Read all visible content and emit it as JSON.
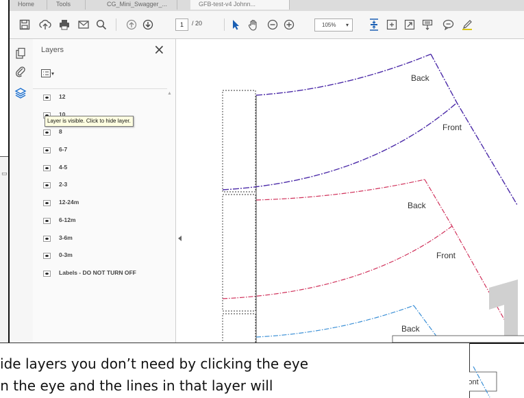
{
  "tabs": [
    "Home",
    "Tools",
    "CG_Mini_Swagger_...",
    "GFB-test-v4 Johnn..."
  ],
  "toolbar": {
    "page_current": "1",
    "page_total": "/ 20",
    "zoom": "105%"
  },
  "layers_panel": {
    "title": "Layers",
    "close_symbol": "×",
    "options_caret": "▾",
    "tooltip": "Layer is visible. Click to hide layer.",
    "layers": [
      "12",
      "10",
      "8",
      "6-7",
      "4-5",
      "2-3",
      "12-24m",
      "6-12m",
      "3-6m",
      "0-3m",
      "Labels - DO NOT TURN OFF"
    ]
  },
  "document": {
    "labels": {
      "back_1": "Back",
      "front_1": "Front",
      "back_2": "Back",
      "front_2": "Front",
      "back_3": "Back",
      "front_3": "Front"
    },
    "line_colors": {
      "purple": "#4b2aa8",
      "red": "#d0305a",
      "blue": "#3a8fd6"
    }
  },
  "callout": {
    "line1": "Hide layers you don’t need by clicking the eye",
    "line2": "on the eye and the lines in that layer will"
  },
  "icons": [
    "save-icon",
    "upload-icon",
    "print-icon",
    "email-icon",
    "zoom-search-icon",
    "prev-page-icon",
    "next-page-icon",
    "select-cursor-icon",
    "hand-tool-icon",
    "zoom-out-icon",
    "zoom-in-icon",
    "fit-page-icon",
    "fit-width-icon",
    "full-screen-icon",
    "keyboard-scroll-icon",
    "comment-icon",
    "highlight-pen-icon",
    "pages-icon",
    "attachments-icon",
    "layers-icon"
  ]
}
